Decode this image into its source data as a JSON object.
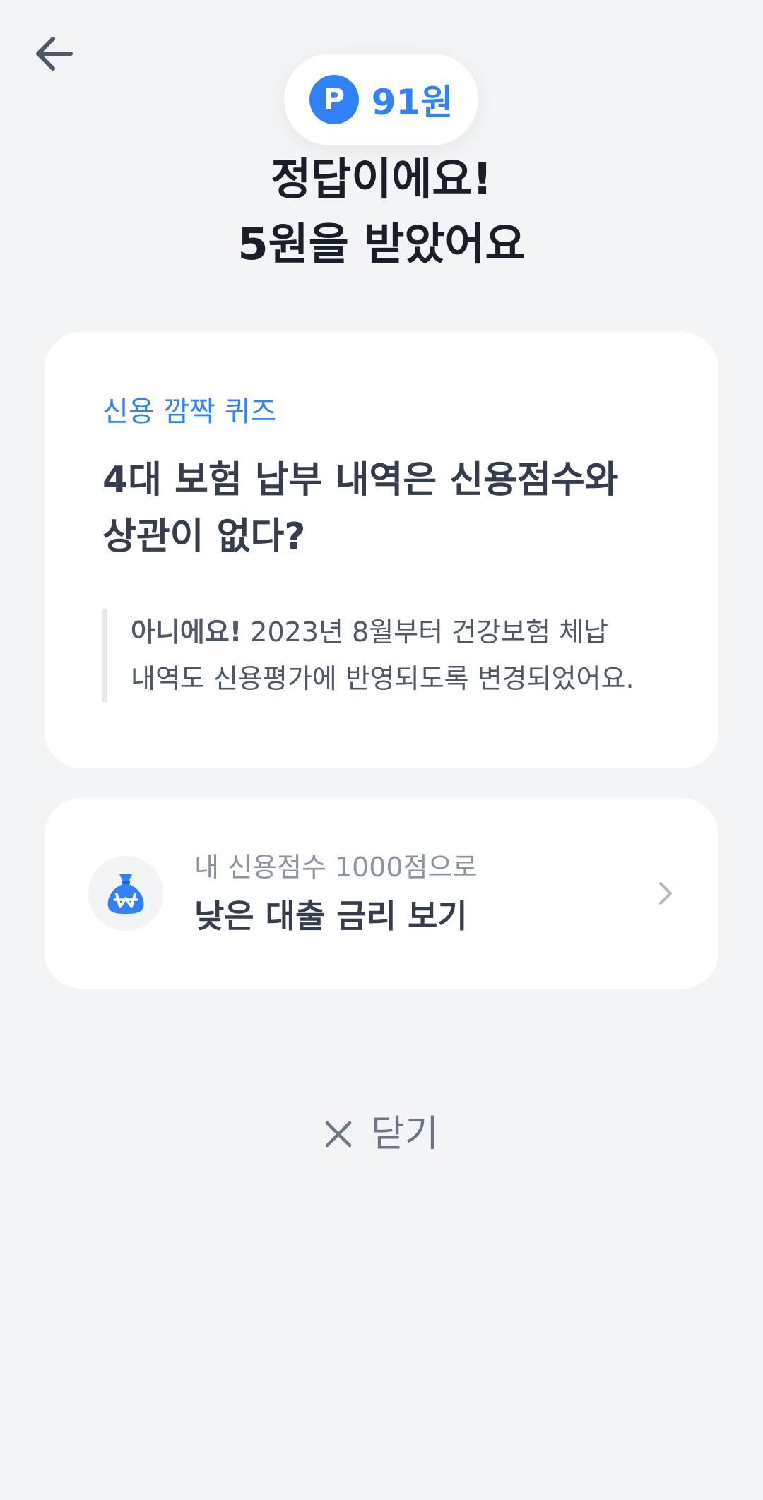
{
  "header": {
    "points_badge_letter": "P",
    "points_amount": "91원"
  },
  "headline": {
    "line1": "정답이에요!",
    "line2": "5원을 받았어요"
  },
  "quiz": {
    "category": "신용 깜짝 퀴즈",
    "question_line1": "4대 보험 납부 내역은 신용점수와",
    "question_line2": "상관이 없다?",
    "answer_lead": "아니에요!",
    "answer_text_line1": "2023년 8월부터 건강보험 체납",
    "answer_text_line2": "내역도 신용평가에 반영되도록 변경되었어요."
  },
  "loan_card": {
    "subtitle": "내 신용점수 1000점으로",
    "title": "낮은 대출 금리 보기"
  },
  "close": {
    "label": "닫기"
  },
  "colors": {
    "accent": "#3182f6",
    "background": "#f2f4f6",
    "card": "#ffffff",
    "text_primary": "#191f28",
    "text_secondary": "#4e5968",
    "text_muted": "#8b95a1"
  },
  "icons": {
    "back": "arrow-left-icon",
    "points": "point-p-icon",
    "loan": "money-bag-won-icon",
    "chevron": "chevron-right-icon",
    "close": "close-x-icon"
  }
}
